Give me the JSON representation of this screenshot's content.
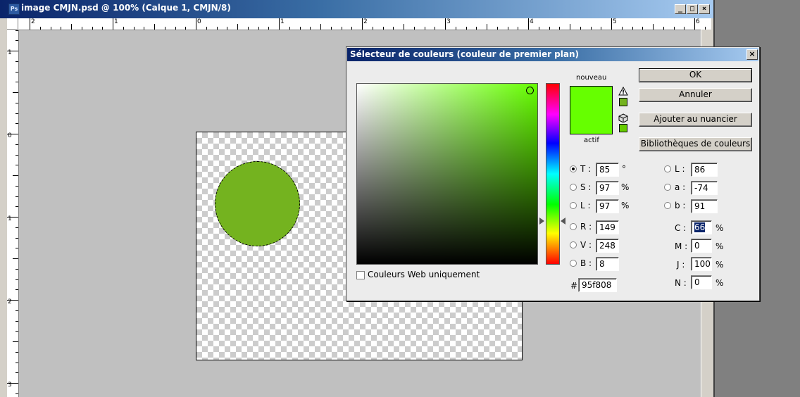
{
  "document": {
    "title": "image CMJN.psd @ 100% (Calque 1, CMJN/8)",
    "app_icon": "Ps",
    "window_buttons": {
      "minimize": "_",
      "maximize": "□",
      "close": "×"
    },
    "hruler_labels": [
      "2",
      "1",
      "0",
      "1",
      "2",
      "3",
      "4",
      "5",
      "6"
    ],
    "vruler_labels": [
      "1",
      "0",
      "1",
      "2",
      "3"
    ]
  },
  "dialog": {
    "title": "Sélecteur de couleurs (couleur de premier plan)",
    "close": "×",
    "new_label": "nouveau",
    "current_label": "actif",
    "buttons": {
      "ok": "OK",
      "cancel": "Annuler",
      "add_swatch": "Ajouter au nuancier",
      "libraries": "Bibliothèques de couleurs"
    },
    "web_only_label": "Couleurs Web uniquement",
    "hsb": [
      {
        "key": "T :",
        "value": "85",
        "unit": "°",
        "selected": true
      },
      {
        "key": "S :",
        "value": "97",
        "unit": "%",
        "selected": false
      },
      {
        "key": "L :",
        "value": "97",
        "unit": "%",
        "selected": false
      }
    ],
    "rgb": [
      {
        "key": "R :",
        "value": "149"
      },
      {
        "key": "V :",
        "value": "248"
      },
      {
        "key": "B :",
        "value": "8"
      }
    ],
    "lab": [
      {
        "key": "L :",
        "value": "86"
      },
      {
        "key": "a :",
        "value": "-74"
      },
      {
        "key": "b :",
        "value": "91"
      }
    ],
    "cmyk": [
      {
        "key": "C :",
        "value": "66",
        "unit": "%"
      },
      {
        "key": "M :",
        "value": "0",
        "unit": "%"
      },
      {
        "key": "J :",
        "value": "100",
        "unit": "%"
      },
      {
        "key": "N :",
        "value": "0",
        "unit": "%"
      }
    ],
    "hex_label": "#",
    "hex_value": "95f808",
    "warning_symbol": "!"
  },
  "colors": {
    "picked": "#66ff00",
    "gamut_swatch": "#74b31f",
    "web_swatch": "#66cc00",
    "circle": "#74b31f"
  }
}
